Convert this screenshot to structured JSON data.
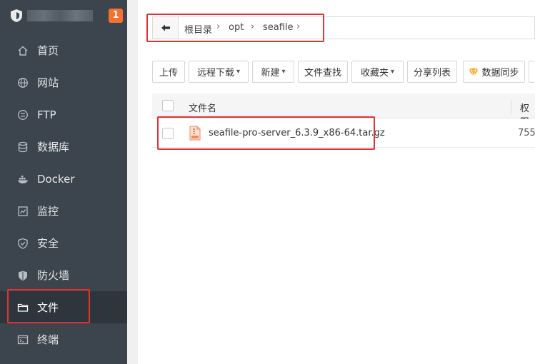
{
  "brand": {
    "notification_count": "1"
  },
  "sidebar": {
    "items": [
      {
        "label": "首页",
        "icon": "home-icon"
      },
      {
        "label": "网站",
        "icon": "globe-icon"
      },
      {
        "label": "FTP",
        "icon": "ftp-icon"
      },
      {
        "label": "数据库",
        "icon": "database-icon"
      },
      {
        "label": "Docker",
        "icon": "docker-icon"
      },
      {
        "label": "监控",
        "icon": "monitor-icon"
      },
      {
        "label": "安全",
        "icon": "shield-icon"
      },
      {
        "label": "防火墙",
        "icon": "firewall-icon"
      },
      {
        "label": "文件",
        "icon": "folder-icon"
      },
      {
        "label": "终端",
        "icon": "terminal-icon"
      }
    ],
    "active": "文件"
  },
  "breadcrumb": {
    "items": [
      "根目录",
      "opt",
      "seafile"
    ]
  },
  "toolbar": {
    "upload": "上传",
    "remote_download": "远程下载",
    "new": "新建",
    "file_search": "文件查找",
    "favorites": "收藏夹",
    "share_list": "分享列表",
    "data_sync": "数据同步"
  },
  "table": {
    "columns": {
      "name": "文件名",
      "permission": "权限"
    },
    "rows": [
      {
        "name": "seafile-pro-server_6.3.9_x86-64.tar.gz",
        "permission": "755"
      }
    ]
  },
  "colors": {
    "sidebar": "#3c444d",
    "active": "#2e353c",
    "badge": "#f5722e",
    "highlight": "#e03333"
  }
}
